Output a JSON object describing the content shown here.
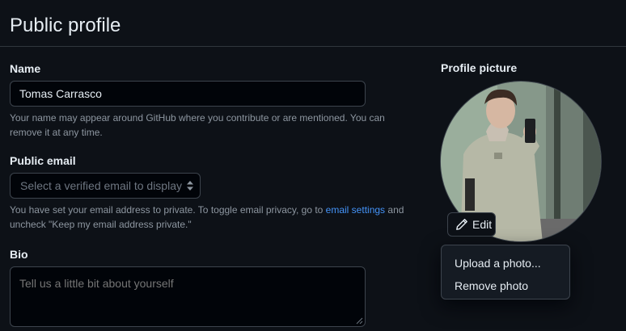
{
  "header": {
    "title": "Public profile"
  },
  "name_section": {
    "label": "Name",
    "value": "Tomas Carrasco",
    "note_line1": "Your name may appear around GitHub where you contribute or are mentioned. You can",
    "note_line2": "remove it at any time."
  },
  "email_section": {
    "label": "Public email",
    "select_placeholder": "Select a verified email to display",
    "note_line1_before": "You have set your email address to private. To toggle email privacy, go to",
    "note_link": "email settings",
    "note_line1_after": "and",
    "note_line2": "uncheck \"Keep my email address private.\""
  },
  "bio_section": {
    "label": "Bio",
    "placeholder": "Tell us a little bit about yourself"
  },
  "profile_picture": {
    "label": "Profile picture",
    "edit_label": "Edit",
    "menu": [
      "Upload a photo...",
      "Remove photo"
    ]
  },
  "colors": {
    "background": "#0d1117",
    "input_background": "#010409",
    "border": "#3d444d",
    "link": "#4493f8",
    "muted_text": "#8d96a0"
  }
}
